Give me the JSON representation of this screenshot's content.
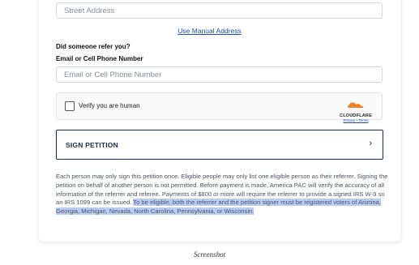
{
  "address": {
    "placeholder": "Street Address",
    "manual_link": "Use Manual Address"
  },
  "referral": {
    "question": "Did someone refer you?",
    "field_label": "Email or Cell Phone Number",
    "placeholder": "Email or Cell Phone Number"
  },
  "captcha": {
    "label": "Verify you are human",
    "brand": "CLOUDFLARE",
    "links": "Privacy • Terms",
    "brand_color": "#f48120"
  },
  "sign_button": {
    "label": "SIGN PETITION",
    "chevron": "›"
  },
  "disclaimer": {
    "text": "Each person may only sign this petition once. Eligible people may only list one eligible person as their referrer. Signing the petition on behalf of another person is not permitted. Before payment is made, America PAC will verify the accuracy of all information of the referrer and referee. Payments of $800 or more will require the referrer to provide a signed IRS W-9 so an IRS 1099 can be issued.",
    "highlighted_text": "To be eligible, both the referrer and the petition signer must be registered voters of Arizona, Georgia, Michigan, Nevada, North Carolina, Pennsylvania, or Wisconsin.",
    "highlight_color": "#b9cdf2"
  },
  "caption": "Screenshot"
}
